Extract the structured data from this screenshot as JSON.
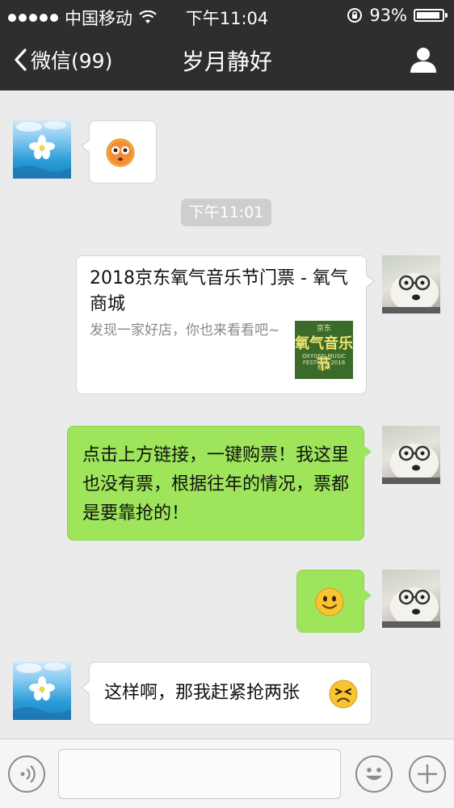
{
  "status_bar": {
    "carrier": "中国移动",
    "time": "下午11:04",
    "battery_percent": "93%",
    "battery_level": 0.93
  },
  "nav": {
    "back_label": "微信(99)",
    "title": "岁月静好"
  },
  "messages": [
    {
      "side": "left",
      "type": "emoji",
      "emoji": "😳"
    },
    {
      "type": "timestamp",
      "text": "下午11:01"
    },
    {
      "side": "right",
      "type": "link",
      "title": "2018京东氧气音乐节门票 - 氧气商城",
      "description": "发现一家好店，你也来看看吧~",
      "thumbnail": {
        "top": "京东",
        "main": "氧气音乐节",
        "sub": "OXYGEN MUSIC FESTIVAL 2018",
        "bottom": "杭州"
      }
    },
    {
      "side": "right",
      "type": "text",
      "text": "点击上方链接，一键购票！我这里也没有票，根据往年的情况，票都是要靠抢的！"
    },
    {
      "side": "right",
      "type": "emoji",
      "emoji": "🙂"
    },
    {
      "side": "left",
      "type": "text",
      "text": "这样啊，那我赶紧抢两张",
      "emoji": "😖"
    }
  ],
  "input_bar": {
    "placeholder": ""
  }
}
